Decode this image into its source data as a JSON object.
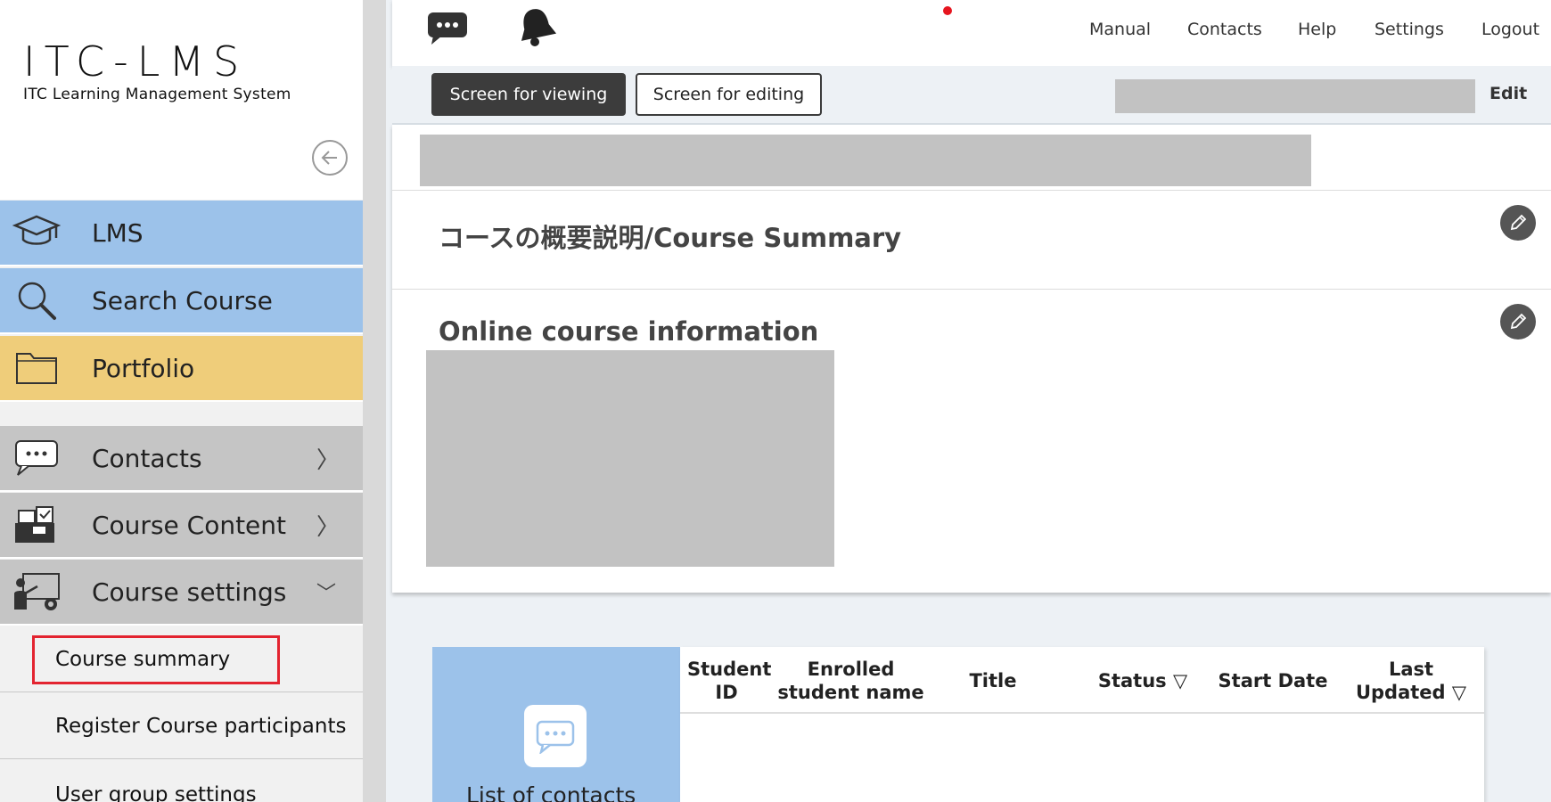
{
  "logo": {
    "main": "ITC-LMS",
    "sub": "ITC Learning Management System"
  },
  "sidebar": {
    "nav": [
      {
        "label": "LMS",
        "icon": "graduation-cap-icon"
      },
      {
        "label": "Search Course",
        "icon": "magnifier-icon"
      },
      {
        "label": "Portfolio",
        "icon": "folder-icon"
      },
      {
        "label": "Contacts",
        "icon": "chat-bubbles-icon",
        "chevron": "〉"
      },
      {
        "label": "Course Content",
        "icon": "course-content-icon",
        "chevron": "〉"
      },
      {
        "label": "Course settings",
        "icon": "teacher-settings-icon",
        "chevron": "﹀"
      }
    ],
    "sub_items": [
      {
        "label": "Course summary"
      },
      {
        "label": "Register Course participants"
      },
      {
        "label": "User group settings"
      }
    ]
  },
  "header": {
    "links": [
      "Manual",
      "Contacts",
      "Help",
      "Settings",
      "Logout"
    ]
  },
  "modebar": {
    "view_label": "Screen for viewing",
    "edit_label": "Screen for editing",
    "edit_link": "Edit"
  },
  "main": {
    "course_summary_heading": "コースの概要説明/Course Summary",
    "online_info_heading": "Online course information"
  },
  "contacts_widget": {
    "label": "List of contacts",
    "columns": [
      {
        "label": "Student ID"
      },
      {
        "label": "Enrolled student name"
      },
      {
        "label": "Title"
      },
      {
        "label": "Status ▽"
      },
      {
        "label": "Start Date"
      },
      {
        "label": "Last Updated ▽"
      }
    ]
  },
  "colors": {
    "nav_blue": "#9cc2ea",
    "nav_yellow": "#efcd7a",
    "nav_gray": "#c5c5c5",
    "highlight_red": "#e32430",
    "notification_red": "#e6151f",
    "dark_button": "#3c3c3c"
  }
}
